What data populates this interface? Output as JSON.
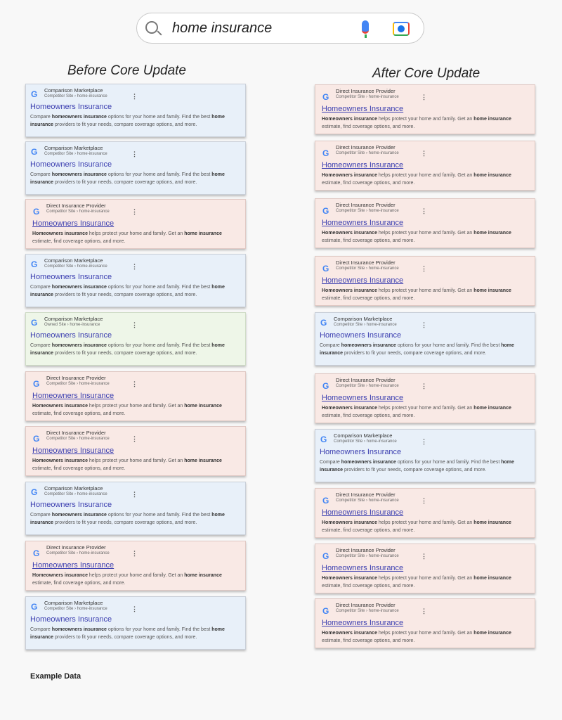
{
  "search": {
    "query": "home insurance",
    "icons": [
      "search-icon",
      "microphone-icon",
      "camera-lens-icon"
    ]
  },
  "columns": {
    "before": "Before Core Update",
    "after": "After Core Update"
  },
  "templates": {
    "comparison": {
      "site": "Comparison Marketplace",
      "crumb": "Competitor Site › home-insurance",
      "title": "Homeowners Insurance",
      "snippet": [
        "Compare ",
        "homeowners insurance",
        " options for your home and family. Find the best ",
        "home insurance",
        " providers to fit your needs, compare coverage options, and more."
      ]
    },
    "owned": {
      "site": "Comparison Marketplace",
      "crumb": "Owned Site › home-insurance",
      "title": "Homeowners Insurance",
      "snippet": [
        "Compare ",
        "homeowners insurance",
        " options for your home and family. Find the best ",
        "home insurance",
        " providers to fit your needs, compare coverage options, and more."
      ]
    },
    "direct": {
      "site": "Direct Insurance Provider",
      "crumb": "Competitor Site › home-insurance",
      "title": "Homeowners Insurance",
      "snippet": [
        "",
        "Homeowners insurance",
        " helps protect your home and family. Get an ",
        "home insurance",
        " estimate, find coverage options, and more."
      ]
    }
  },
  "before_results": [
    "comparison",
    "comparison",
    "direct",
    "comparison",
    "owned",
    "direct",
    "direct",
    "comparison",
    "direct",
    "comparison"
  ],
  "after_results": [
    "direct",
    "direct",
    "direct",
    "direct",
    "comparison",
    "direct",
    "comparison",
    "direct",
    "direct",
    "direct"
  ],
  "colors": {
    "comparison": "#e8f0f9",
    "owned": "#eef6e8",
    "direct": "#f9e9e5",
    "link": "#3c3fb0"
  },
  "footer": "Example Data"
}
